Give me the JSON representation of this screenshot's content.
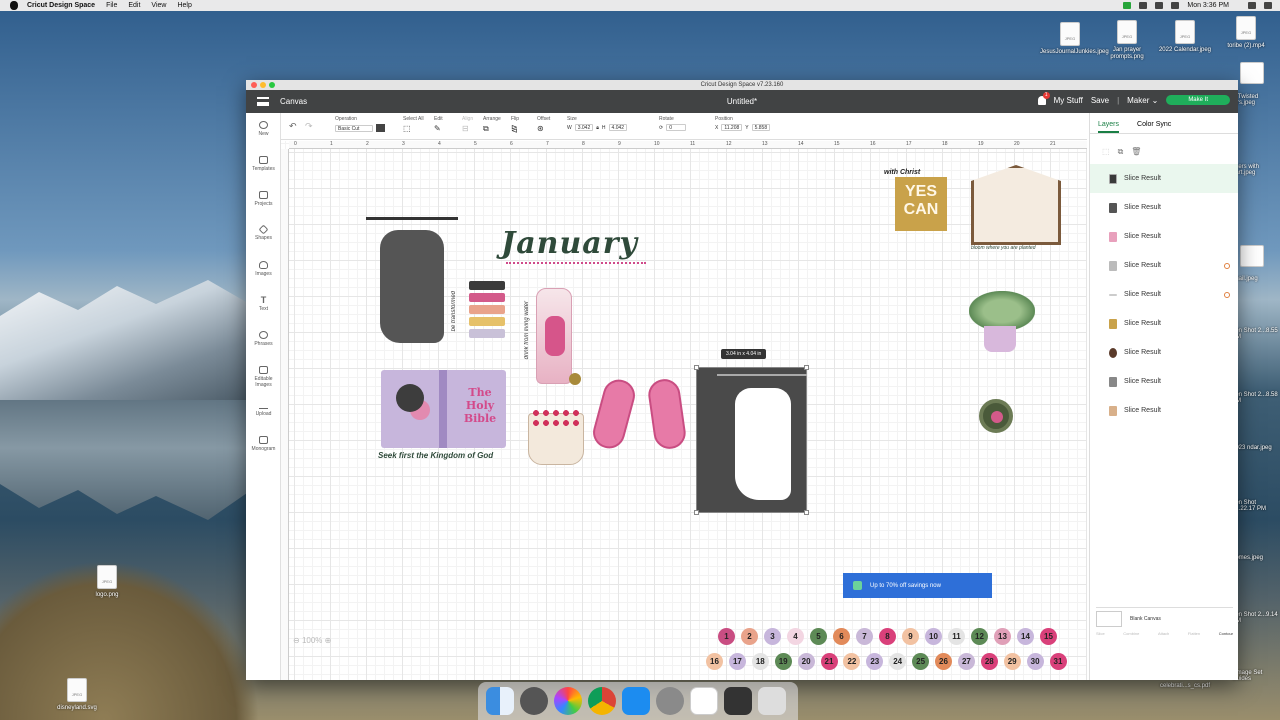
{
  "menubar": {
    "app": "Cricut Design Space",
    "items": [
      "File",
      "Edit",
      "View",
      "Help"
    ],
    "clock": "Mon 3:36 PM"
  },
  "desktop": {
    "icons": [
      {
        "name": "JesusJournalJunkies.jpeg"
      },
      {
        "name": "Jan prayer prompts.png"
      },
      {
        "name": "2022 Calendar.jpeg"
      },
      {
        "name": "toribe (2).mp4"
      },
      {
        "name": "logo.png"
      },
      {
        "name": "disneyland.svg"
      }
    ],
    "partial": [
      "H Twisted ters.jpeg",
      "akers with eart.jpeg",
      "bnail.jpeg",
      "een Shot 2...8.55 PM",
      "een Shot 2...8.58 PM",
      "2023 ndar.jpeg",
      "een Shot 2...22.17 PM",
      "homes.jpeg",
      "een Shot 2...9.14 PM",
      "l Image Set Guides",
      "celebrati...s_cs.pdf"
    ]
  },
  "window": {
    "title": "Cricut Design Space  v7.23.160",
    "topbar": {
      "section": "Canvas",
      "document": "Untitled*",
      "my_stuff": "My Stuff",
      "save": "Save",
      "machine": "Maker",
      "make_it": "Make It",
      "notifications": "1"
    },
    "toolbar": {
      "operation_cap": "Operation",
      "operation_value": "Basic Cut",
      "select_all": "Select All",
      "edit": "Edit",
      "align": "Align",
      "arrange": "Arrange",
      "flip": "Flip",
      "offset": "Offset",
      "size_cap": "Size",
      "w_label": "W",
      "w_value": "3.042",
      "h_label": "H",
      "h_value": "4.042",
      "rotate_cap": "Rotate",
      "rotate_value": "0",
      "position_cap": "Position",
      "x_label": "X",
      "x_value": "11.208",
      "y_label": "Y",
      "y_value": "5.858"
    },
    "leftbar": [
      {
        "label": "New",
        "icon": "plus-icon"
      },
      {
        "label": "Templates",
        "icon": "shirt-icon"
      },
      {
        "label": "Projects",
        "icon": "projects-icon"
      },
      {
        "label": "Shapes",
        "icon": "shapes-icon"
      },
      {
        "label": "Images",
        "icon": "bulb-icon"
      },
      {
        "label": "Text",
        "icon": "text-icon"
      },
      {
        "label": "Phrases",
        "icon": "phrases-icon"
      },
      {
        "label": "Editable Images",
        "icon": "editable-icon"
      },
      {
        "label": "Upload",
        "icon": "upload-icon"
      },
      {
        "label": "Monogram",
        "icon": "monogram-icon"
      }
    ],
    "ruler": [
      "0",
      "1",
      "2",
      "3",
      "4",
      "5",
      "6",
      "7",
      "8",
      "9",
      "10",
      "11",
      "12",
      "13",
      "14",
      "15",
      "16",
      "17",
      "18",
      "19",
      "20",
      "21"
    ],
    "canvas": {
      "january": "January",
      "yes_can_top": "with Christ",
      "yes_can": "YES CAN",
      "bloom": "bloom where you are planted",
      "bible_title": "The Holy Bible",
      "seek": "Seek first the Kingdom of God",
      "transformed": "be transformed",
      "drink": "drink from living water",
      "size_tooltip": "3.04  in x 4.04  in",
      "zoom": "100%",
      "numbers": [
        "1",
        "2",
        "3",
        "4",
        "5",
        "6",
        "7",
        "8",
        "9",
        "10",
        "11",
        "12",
        "13",
        "14",
        "15",
        "16",
        "17",
        "18",
        "19",
        "20",
        "21",
        "22",
        "23",
        "24",
        "25",
        "26",
        "27",
        "28",
        "29",
        "30",
        "31"
      ]
    },
    "layers_panel": {
      "tab_layers": "Layers",
      "tab_color_sync": "Color Sync",
      "layers": [
        "Slice Result",
        "Slice Result",
        "Slice Result",
        "Slice Result",
        "Slice Result",
        "Slice Result",
        "Slice Result",
        "Slice Result",
        "Slice Result"
      ],
      "blank_canvas": "Blank Canvas",
      "bottom_actions": [
        "Slice",
        "Combine",
        "Attach",
        "Flatten",
        "Contour"
      ],
      "promo": "Up to 70% off savings now"
    }
  },
  "colors": {
    "accent": "#1a7f45",
    "topbar": "#414344",
    "make_it": "#1fae5b",
    "promo": "#2e6fd8"
  }
}
